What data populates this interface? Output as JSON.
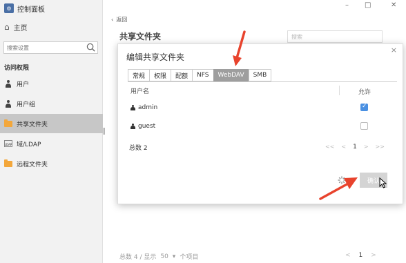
{
  "app": {
    "title": "控制面板"
  },
  "window": {
    "minimize": "–",
    "maximize": "□",
    "close": "✕"
  },
  "sidebar": {
    "home": "主页",
    "search_placeholder": "搜索设置",
    "section_title": "访问权限",
    "items": [
      {
        "label": "用户",
        "icon": "user-icon"
      },
      {
        "label": "用户组",
        "icon": "group-icon"
      },
      {
        "label": "共享文件夹",
        "icon": "folder-icon",
        "active": true
      },
      {
        "label": "域/LDAP",
        "icon": "ldap-icon"
      },
      {
        "label": "远程文件夹",
        "icon": "folder-icon"
      }
    ]
  },
  "main": {
    "back_label": "返回",
    "title": "共享文件夹",
    "search_placeholder": "搜索",
    "footer": {
      "summary": "总数 4 / 显示",
      "page_size": "50",
      "items_label": "个项目"
    },
    "pager": {
      "first": "<<",
      "prev": "<",
      "current": "1",
      "next": ">"
    }
  },
  "modal": {
    "title": "编辑共享文件夹",
    "close": "×",
    "tabs": [
      "常规",
      "权限",
      "配额",
      "NFS",
      "WebDAV",
      "SMB"
    ],
    "active_tab": "WebDAV",
    "columns": {
      "user": "用户名",
      "allow": "允许"
    },
    "rows": [
      {
        "name": "admin",
        "allowed": true
      },
      {
        "name": "guest",
        "allowed": false
      }
    ],
    "total": "总数 2",
    "pager": {
      "first": "<<",
      "prev": "<",
      "current": "1",
      "next": ">",
      "last": ">>"
    },
    "ok_label": "确认"
  },
  "colors": {
    "accent_arrow": "#e8432d",
    "checkbox_on": "#4a90e2",
    "active_tab": "#9e9e9e",
    "folder": "#f3a73b"
  }
}
